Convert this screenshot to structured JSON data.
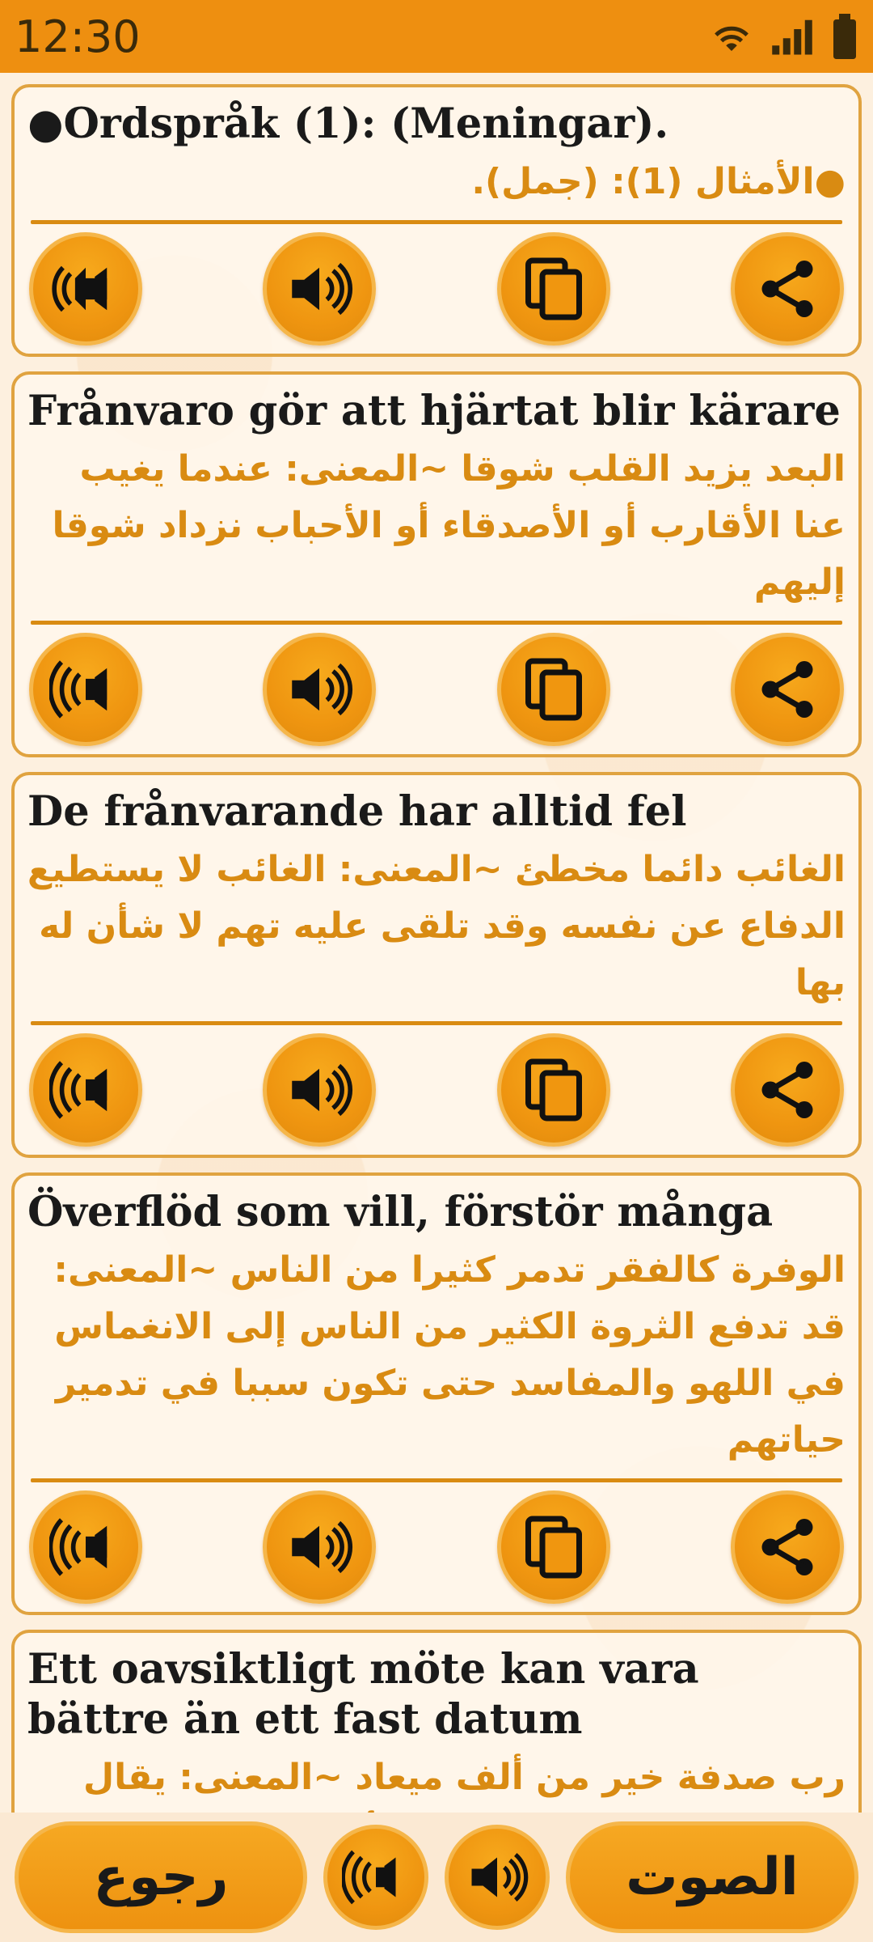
{
  "status_bar": {
    "time": "12:30"
  },
  "cards": [
    {
      "swedish": "●Ordspråk (1): (Meningar).",
      "arabic": "●الأمثال (1): (جمل)."
    },
    {
      "swedish": "Frånvaro gör att hjärtat blir kärare",
      "arabic": "البعد يزيد القلب شوقا ~المعنى: عندما يغيب عنا الأقارب أو الأصدقاء أو الأحباب نزداد شوقا إليهم"
    },
    {
      "swedish": "De frånvarande har alltid fel",
      "arabic": "الغائب دائما مخطئ ~المعنى: الغائب لا يستطيع الدفاع عن نفسه وقد تلقى عليه تهم لا شأن له بها"
    },
    {
      "swedish": "Överflöd som vill, förstör många",
      "arabic": "الوفرة كالفقر تدمر كثيرا من الناس ~المعنى: قد تدفع الثروة الكثير من الناس إلى الانغماس في اللهو والمفاسد حتى تكون سببا في تدمير حياتهم"
    },
    {
      "swedish": "Ett oavsiktligt möte kan vara bättre än ett fast datum",
      "arabic": "رب صدفة خير من ألف ميعاد ~المعنى: يقال هذا المثل حين تحصل مفاجأة سارة غير متوقعة لم يتم الإعداد أو الترتيب لها من قبل"
    }
  ],
  "card_buttons": [
    "slow-speaker-icon",
    "speaker-icon",
    "copy-icon",
    "share-icon"
  ],
  "bottom_bar": {
    "back_label": "رجوع",
    "sound_label": "الصوت"
  },
  "colors": {
    "accent": "#ee8f10",
    "arabic_text": "#d98b12",
    "card_border": "#e0a340",
    "background": "#fdf0df"
  }
}
